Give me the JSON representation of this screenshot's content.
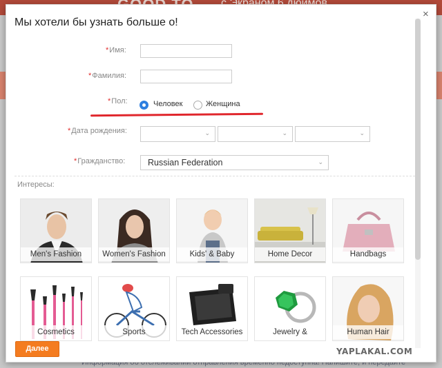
{
  "background": {
    "banner_text": "GOOD TO",
    "banner_subtitle": "с Экраном 6 дюймов",
    "footer_text": "Информация об отслеживании отправления временно недоступна! Напишите, и передайте"
  },
  "modal": {
    "title": "Мы хотели бы узнать больше о!",
    "close_label": "×"
  },
  "form": {
    "required_mark": "*",
    "first_name_label": "Имя:",
    "last_name_label": "Фамилия:",
    "gender_label": "Пол:",
    "gender_options": [
      "Человек",
      "Женщина"
    ],
    "gender_selected": "Человек",
    "birthdate_label": "Дата рождения:",
    "citizenship_label": "Гражданство:",
    "citizenship_value": "Russian Federation"
  },
  "interests": {
    "label": "Интересы:",
    "row1": [
      "Men's Fashion",
      "Women's Fashion",
      "Kids' & Baby",
      "Home Decor",
      "Handbags"
    ],
    "row2": [
      "Cosmetics",
      "Sports",
      "Tech Accessories",
      "Jewelry &",
      "Human Hair"
    ]
  },
  "footer": {
    "next_label": "Далее",
    "watermark": "YAPLAKAL.COM"
  },
  "colors": {
    "accent_orange": "#f47c20",
    "radio_blue": "#2d7fe0",
    "required_red": "#e12c2c",
    "annotation_red": "#e0262c"
  },
  "icons": {
    "close": "close-icon",
    "select": "chevron-down-icon"
  }
}
